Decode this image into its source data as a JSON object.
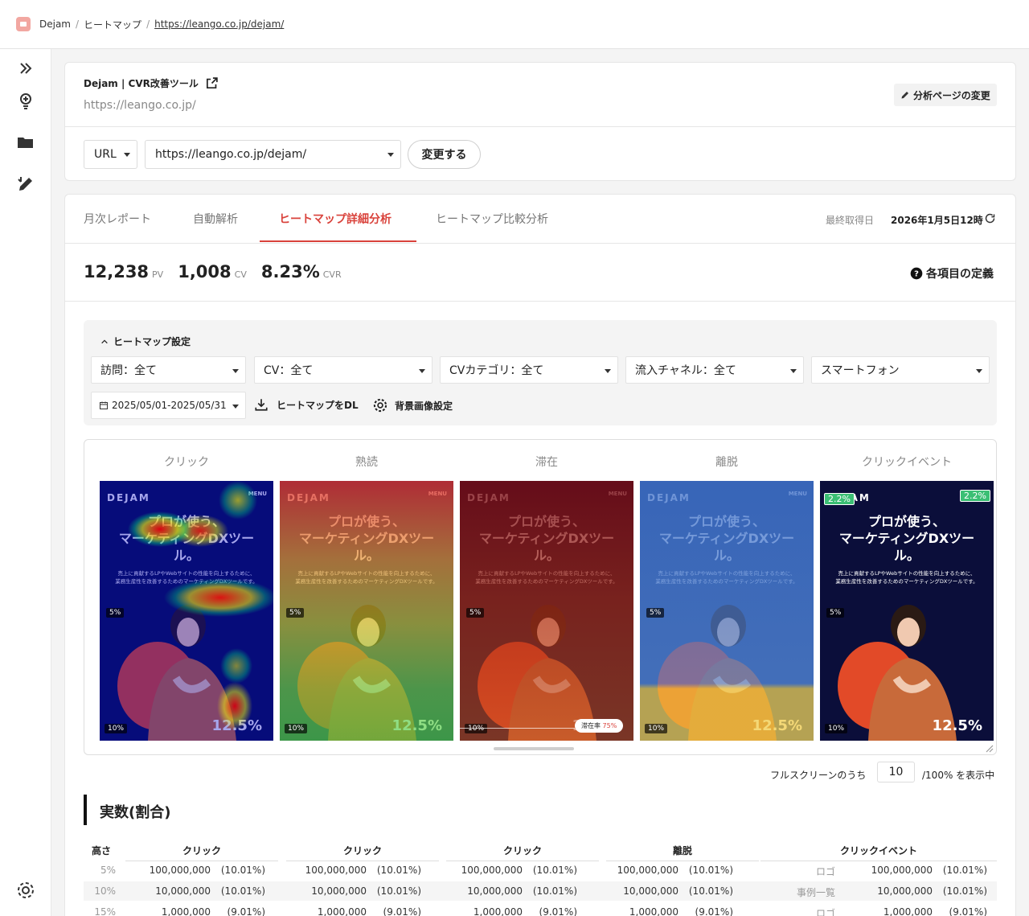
{
  "breadcrumb": {
    "app": "Dejam",
    "section": "ヒートマップ",
    "url": "https://leango.co.jp/dejam/"
  },
  "site": {
    "name": "Dejam | CVR改善ツール",
    "url": "https://leango.co.jp/",
    "change_page_label": "分析ページの変更"
  },
  "url_selector": {
    "type_label": "URL",
    "value": "https://leango.co.jp/dejam/",
    "apply_label": "変更する"
  },
  "tabs": [
    {
      "label": "月次レポート"
    },
    {
      "label": "自動解析"
    },
    {
      "label": "ヒートマップ詳細分析",
      "active": true
    },
    {
      "label": "ヒートマップ比較分析"
    }
  ],
  "last_fetch": {
    "label": "最終取得日",
    "value": "2026年1月5日12時"
  },
  "stats": {
    "pv": {
      "value": "12,238",
      "unit": "PV"
    },
    "cv": {
      "value": "1,008",
      "unit": "CV"
    },
    "cvr": {
      "value": "8.23%",
      "unit": "CVR"
    },
    "definition_label": "各項目の定義"
  },
  "settings": {
    "title": "ヒートマップ設定",
    "filters": [
      "訪問：全て",
      "CV：全て",
      "CVカテゴリ：全て",
      "流入チャネル：全て",
      "スマートフォン"
    ],
    "date_range": "2025/05/01-2025/05/31",
    "download_label": "ヒートマップをDL",
    "bg_label": "背景画像設定"
  },
  "heatmaps": {
    "columns": [
      "クリック",
      "熟読",
      "滞在",
      "離脱",
      "クリックイベント"
    ],
    "page": {
      "brand": "DEJAM",
      "menu": "MENU",
      "headline_1": "プロが使う、",
      "headline_2": "マーケティングDXツー",
      "headline_3": "ル。",
      "sub_1": "売上に貢献するLPやWebサイトの性能を向上するために、",
      "sub_2": "業務生産性を改善するためのマーケティングDXツールです。",
      "big_pct": "12.5%"
    },
    "tag_5": "5%",
    "tag_10": "10%",
    "dwell_badge_label": "滞在率",
    "dwell_badge_value": "75%",
    "event_badge": "2.2%"
  },
  "fullscreen": {
    "prefix": "フルスクリーンのうち",
    "value": "10",
    "suffix": "/100% を表示中"
  },
  "table": {
    "title": "実数(割合)",
    "headers": [
      "高さ",
      "クリック",
      "クリック",
      "クリック",
      "離脱",
      "クリックイベント"
    ],
    "rows": [
      {
        "height": "5%",
        "c1": "100,000,000",
        "p1": "(10.01%)",
        "c2": "100,000,000",
        "p2": "(10.01%)",
        "c3": "100,000,000",
        "p3": "(10.01%)",
        "c4": "100,000,000",
        "p4": "(10.01%)",
        "ev": "ロゴ",
        "c5": "100,000,000",
        "p5": "(10.01%)"
      },
      {
        "height": "10%",
        "c1": "10,000,000",
        "p1": "(10.01%)",
        "c2": "10,000,000",
        "p2": "(10.01%)",
        "c3": "10,000,000",
        "p3": "(10.01%)",
        "c4": "10,000,000",
        "p4": "(10.01%)",
        "ev": "事例一覧",
        "c5": "10,000,000",
        "p5": "(10.01%)"
      },
      {
        "height": "15%",
        "c1": "1,000,000",
        "p1": "(9.01%)",
        "c2": "1,000,000",
        "p2": "(9.01%)",
        "c3": "1,000,000",
        "p3": "(9.01%)",
        "c4": "1,000,000",
        "p4": "(9.01%)",
        "ev": "ロゴ",
        "c5": "1,000,000",
        "p5": "(9.01%)"
      }
    ]
  },
  "colors": {
    "accent": "#d9423b",
    "green_badge": "#3bbf74"
  },
  "icons": [
    "expand-icon",
    "lightbulb-icon",
    "folder-icon",
    "edit-icon",
    "settings-icon",
    "external-link-icon",
    "pencil-icon",
    "refresh-icon",
    "help-icon",
    "chevron-up-icon",
    "calendar-icon",
    "download-icon",
    "gear-icon",
    "resize-icon"
  ]
}
